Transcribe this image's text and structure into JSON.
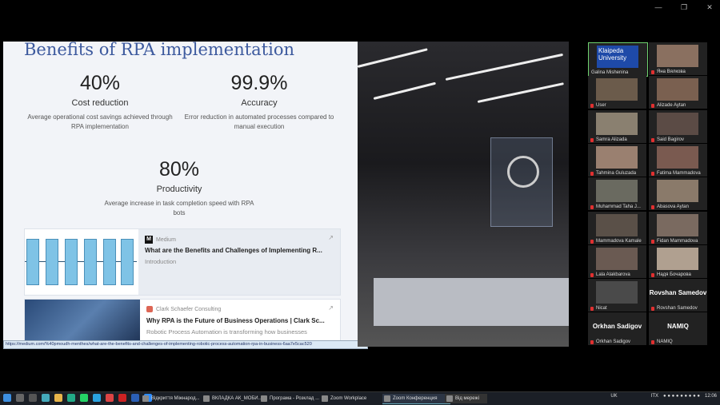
{
  "slide": {
    "title": "Benefits of RPA implementation",
    "stats": [
      {
        "value": "40%",
        "label": "Cost reduction",
        "desc1": "Average operational cost savings achieved through",
        "desc2": "RPA implementation"
      },
      {
        "value": "99.9%",
        "label": "Accuracy",
        "desc1": "Error reduction in automated processes compared to",
        "desc2": "manual execution"
      },
      {
        "value": "80%",
        "label": "Productivity",
        "desc1": "Average increase in task completion speed with RPA",
        "desc2": "bots"
      }
    ],
    "cards": [
      {
        "source": "Medium",
        "source_icon": "M",
        "title": "What are the Benefits and Challenges of Implementing R...",
        "sub": "Introduction"
      },
      {
        "source": "Clark Schaefer Consulting",
        "title": "Why RPA is the Future of Business Operations | Clark Sc...",
        "sub": "Robotic Process Automation is transforming how businesses"
      }
    ],
    "status_url": "https://medium.com/%40pmoudh-menthes/what-are-the-benefits-and-challenges-of-implementing-robotic-process-automation-rpa-in-business-6aa7e5cac520"
  },
  "participants": [
    {
      "name": "Galina Mishenina"
    },
    {
      "name": "Яна Вялкова"
    },
    {
      "name": "User"
    },
    {
      "name": "Alizade Aytan"
    },
    {
      "name": "Samra Alizada"
    },
    {
      "name": "Said Bagirov"
    },
    {
      "name": "Tahmina Guluzada"
    },
    {
      "name": "Fatima Mammadova"
    },
    {
      "name": "Muhammad Taha J..."
    },
    {
      "name": "Abasova Aytan"
    },
    {
      "name": "Mammadova Kamale"
    },
    {
      "name": "Fidan Mammadova"
    },
    {
      "name": "Lala Alakbarova"
    },
    {
      "name": "Надя Бочарова"
    },
    {
      "name": "Nicat"
    },
    {
      "name": "Rovshan Samedov",
      "big": "Rovshan Samedov"
    },
    {
      "name": "Orkhan Sadigov",
      "big": "Orkhan Sadigov"
    },
    {
      "name": "NAMIQ",
      "big": "NAMIQ"
    }
  ],
  "participant_logo": "Klaipeda University",
  "taskbar": {
    "apps": [
      "Відкриття Міжнарод...",
      "ВКЛАДКА АК_МОБИ...",
      "Програма - Розклад ...",
      "Zoom Workplace",
      "Zoom Конференция",
      "Від мережі"
    ],
    "lang": "UK",
    "tray_label": "ITX",
    "time": "12:06"
  },
  "colors": {
    "accent": "#3d5a9e",
    "mic_off": "#e03030"
  }
}
